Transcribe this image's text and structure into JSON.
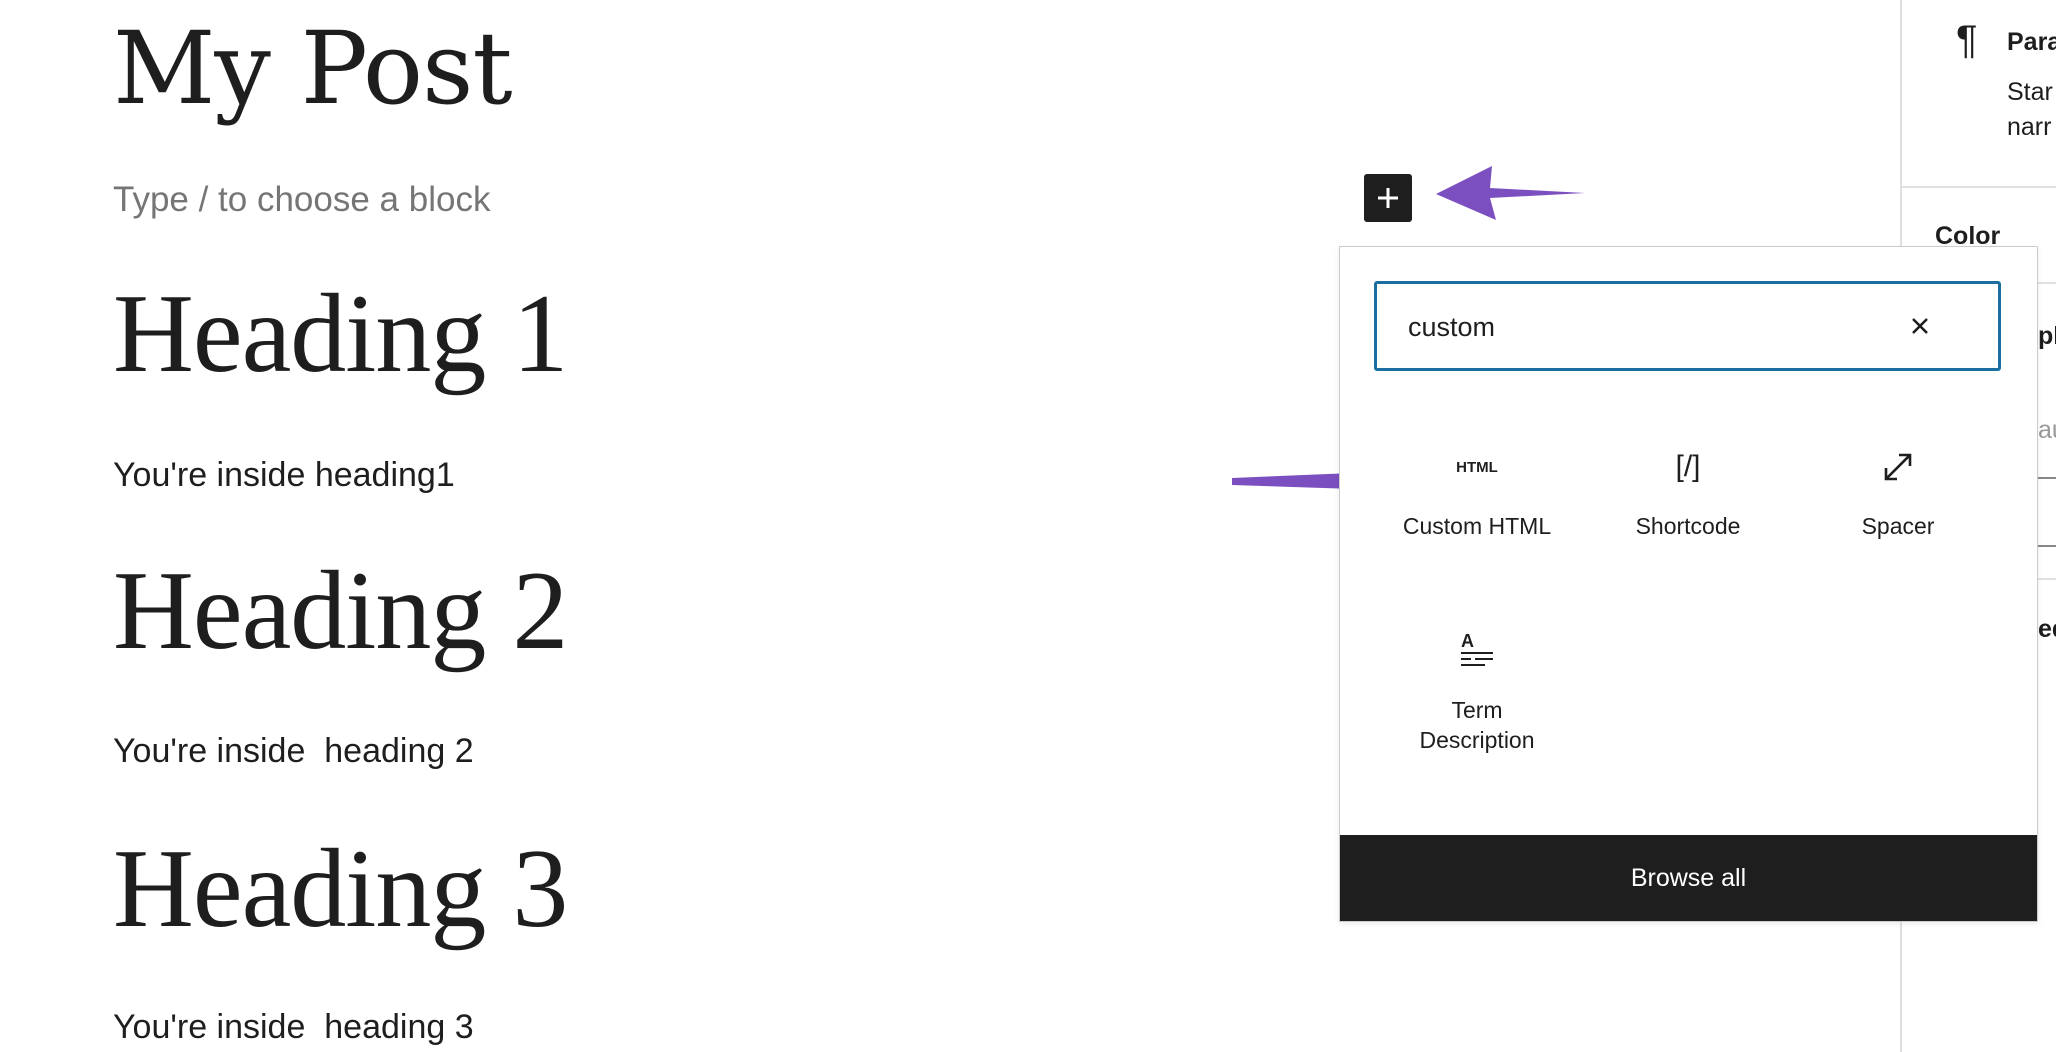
{
  "editor": {
    "post_title": "My Post",
    "block_placeholder": "Type / to choose a block",
    "blocks": [
      {
        "heading": "Heading 1",
        "paragraph": "You're inside heading1"
      },
      {
        "heading": "Heading 2",
        "paragraph": "You're inside  heading 2"
      },
      {
        "heading": "Heading 3",
        "paragraph": "You're inside  heading 3"
      }
    ]
  },
  "inserter": {
    "search_value": "custom",
    "results": [
      {
        "label": "Custom HTML",
        "icon": "html-icon",
        "icon_text": "HTML"
      },
      {
        "label": "Shortcode",
        "icon": "shortcode-icon",
        "icon_text": "[/]"
      },
      {
        "label": "Spacer",
        "icon": "spacer-icon"
      },
      {
        "label": "Term Description",
        "icon": "term-description-icon",
        "icon_text": "A"
      }
    ],
    "browse_all_label": "Browse all"
  },
  "sidebar": {
    "block_icon": "¶",
    "block_name_partial": "Para",
    "block_desc_line1_partial": "Star",
    "block_desc_line2_partial": "narr",
    "color_label": "Color",
    "partial_label_1": "pl",
    "partial_value_1": "au",
    "partial_label_2": "ed"
  },
  "annotation_color": "#7b4fc0"
}
